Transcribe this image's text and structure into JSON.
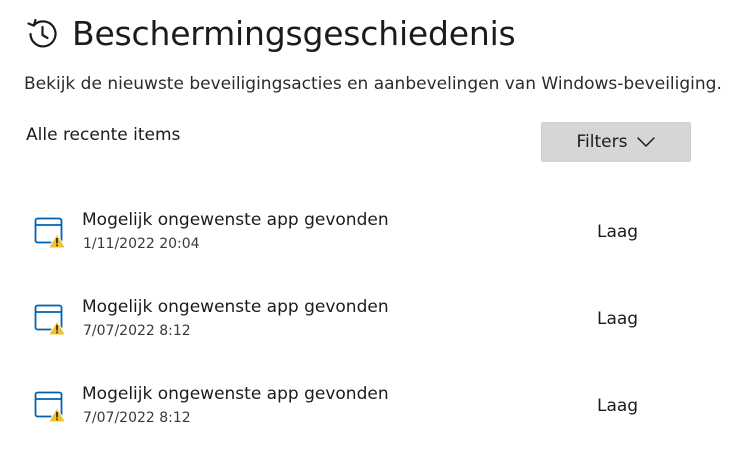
{
  "header": {
    "title": "Beschermingsgeschiedenis",
    "icon": "history-icon"
  },
  "subtitle": "Bekijk de nieuwste beveiligingsacties en aanbevelingen van Windows-beveiliging.",
  "section": {
    "title": "Alle recente items"
  },
  "filters": {
    "label": "Filters",
    "icon": "chevron-down-icon"
  },
  "items": [
    {
      "title": "Mogelijk ongewenste app gevonden",
      "date": "1/11/2022 20:04",
      "severity": "Laag",
      "icon": "app-warning-icon"
    },
    {
      "title": "Mogelijk ongewenste app gevonden",
      "date": "7/07/2022 8:12",
      "severity": "Laag",
      "icon": "app-warning-icon"
    },
    {
      "title": "Mogelijk ongewenste app gevonden",
      "date": "7/07/2022 8:12",
      "severity": "Laag",
      "icon": "app-warning-icon"
    }
  ],
  "colors": {
    "icon_blue": "#0063b1",
    "warning_yellow": "#f2c12e",
    "button_bg": "#d6d6d6"
  }
}
